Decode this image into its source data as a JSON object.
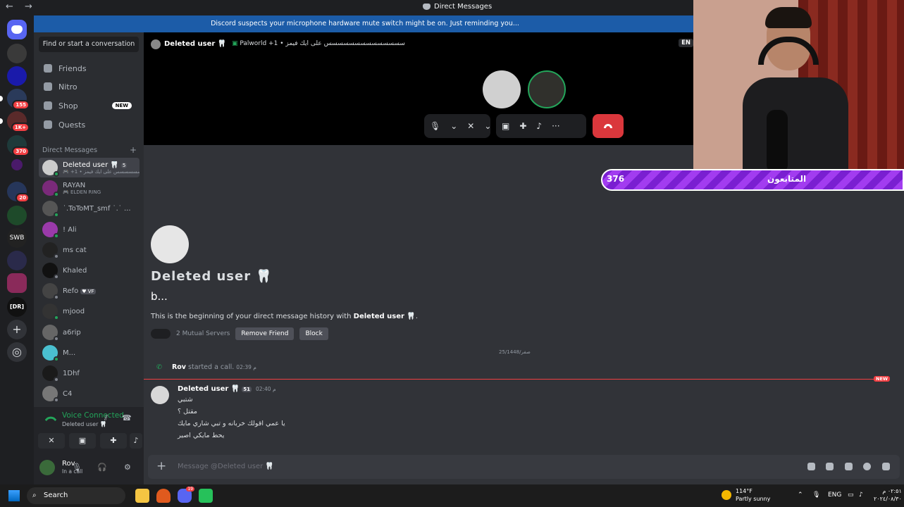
{
  "window": {
    "title": "Direct Messages",
    "nav": "← →"
  },
  "banner": "Discord suspects your microphone hardware mute switch might be on. Just reminding you...",
  "servers": [
    {
      "badge": ""
    },
    {
      "badge": ""
    },
    {
      "badge": ""
    },
    {
      "badge": "155"
    },
    {
      "badge": "1K+"
    },
    {
      "badge": "370"
    },
    {
      "badge": ""
    },
    {
      "badge": "20"
    },
    {
      "badge": ""
    },
    {
      "badge": ""
    },
    {
      "badge": ""
    },
    {
      "badge": ""
    },
    {
      "badge": ""
    }
  ],
  "server_labels": {
    "swb": "SWB",
    "dr": "[DR]"
  },
  "sidebar": {
    "find": "Find or start a conversation",
    "nav": [
      {
        "label": "Friends",
        "icon": "friends-icon"
      },
      {
        "label": "Nitro",
        "icon": "nitro-icon"
      },
      {
        "label": "Shop",
        "icon": "shop-icon",
        "badge": "NEW"
      },
      {
        "label": "Quests",
        "icon": "quests-icon"
      }
    ],
    "dm_header": "Direct Messages",
    "dm_plus": "+",
    "dms": [
      {
        "name": "Deleted user 🦷",
        "tag": "5",
        "sub": "🎮 +1 • سسسسسسسس على ايك فيمز",
        "active": true,
        "online": true
      },
      {
        "name": "RAYAN",
        "tag": "",
        "sub": "🎮 ELDEN RING",
        "active": false,
        "online": true
      },
      {
        "name": "˙.ToToMT_smf ˙.˙ ...",
        "tag": "",
        "sub": "",
        "active": false,
        "online": true
      },
      {
        "name": "! Ali",
        "tag": "",
        "sub": "",
        "active": false,
        "online": true
      },
      {
        "name": "ms cat",
        "tag": "",
        "sub": "",
        "active": false,
        "online": false
      },
      {
        "name": "Khaled",
        "tag": "",
        "sub": "",
        "active": false,
        "online": false
      },
      {
        "name": "Refo",
        "tag": "♥ VF",
        "sub": "",
        "active": false,
        "online": false
      },
      {
        "name": "mjood",
        "tag": "",
        "sub": "",
        "active": false,
        "online": true
      },
      {
        "name": "a6rip",
        "tag": "",
        "sub": "",
        "active": false,
        "online": false
      },
      {
        "name": "M...",
        "tag": "",
        "sub": "",
        "active": false,
        "online": true
      },
      {
        "name": "1Dhf",
        "tag": "",
        "sub": "",
        "active": false,
        "online": false
      },
      {
        "name": "C4",
        "tag": "",
        "sub": "",
        "active": false,
        "online": false
      }
    ]
  },
  "voice": {
    "status": "Voice Connected",
    "channel": "Deleted user 🦷"
  },
  "user": {
    "name": "Rov",
    "status": "In a call"
  },
  "header": {
    "username": "Deleted user 🦷",
    "activity_game": "Palworld +1",
    "activity_text": "• سسسسسسسسسسسسسس على ايك فيمز",
    "lang": "EN"
  },
  "call": {
    "more": "···"
  },
  "profile": {
    "name": "Deleted user 🦷",
    "bio": "b...",
    "intro_prefix": "This is the beginning of your direct message history with ",
    "intro_name": "Deleted user 🦷",
    "intro_suffix": ".",
    "mutual": "2 Mutual Servers",
    "remove": "Remove Friend",
    "block": "Block"
  },
  "date_divider": "25/1448/صفر",
  "system": {
    "user": "Rov",
    "text": "started a call.",
    "time": "02:39 م"
  },
  "new_label": "NEW",
  "message": {
    "user": "Deleted user 🦷",
    "tag": "51",
    "time": "02:40 م",
    "lines": [
      "شتبي",
      "مقتل ؟",
      "يا عمي اقولك خربانه و تبي شاري مايك",
      "يحط مايكي اصير"
    ]
  },
  "composer": {
    "placeholder": "Message @Deleted user 🦷",
    "plus": "+"
  },
  "overlay": {
    "followers": "376",
    "label": "المتابعون"
  },
  "taskbar": {
    "search": "Search",
    "notif_count": "19",
    "temp": "114°F",
    "weather": "Partly sunny",
    "lang": "ENG",
    "time": "٠٢:٥١ م",
    "date": "٢٠٢٤/٠٨/٣٠"
  },
  "colors": {
    "accent": "#5865f2",
    "online": "#23a55a",
    "danger": "#da373c",
    "banner": "#1c5ca8",
    "overlay": "#a23cf0"
  }
}
